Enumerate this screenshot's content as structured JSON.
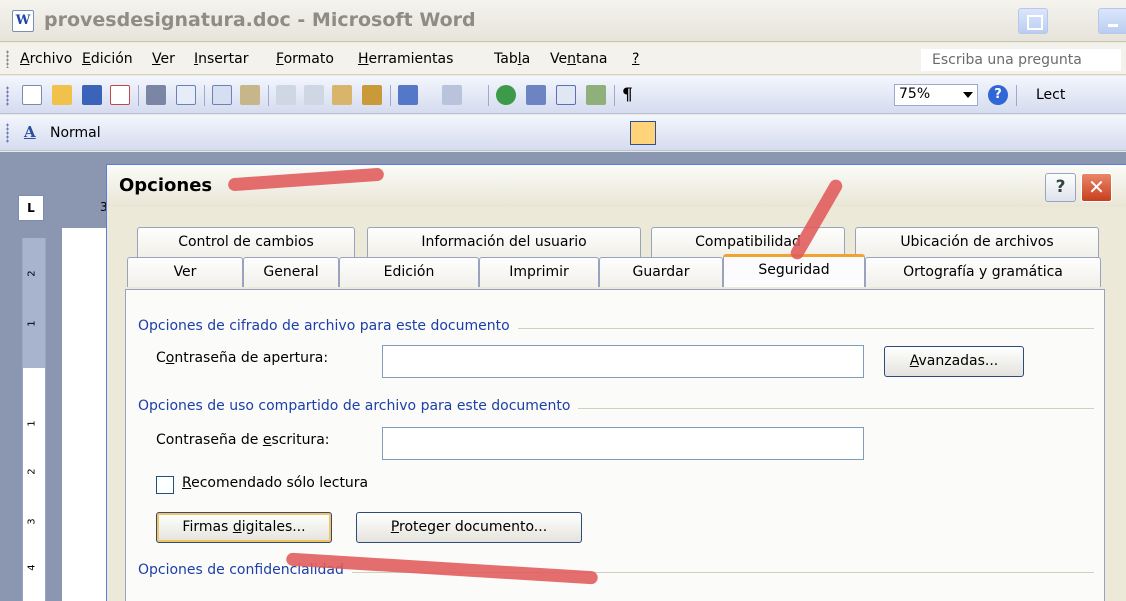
{
  "word_window": {
    "title": "provesdesignatura.doc - Microsoft Word"
  },
  "menubar": {
    "items": [
      {
        "prefix": "",
        "ul": "A",
        "rest": "rchivo"
      },
      {
        "prefix": "",
        "ul": "E",
        "rest": "dición"
      },
      {
        "prefix": "",
        "ul": "V",
        "rest": "er"
      },
      {
        "prefix": "",
        "ul": "I",
        "rest": "nsertar"
      },
      {
        "prefix": "",
        "ul": "F",
        "rest": "ormato"
      },
      {
        "prefix": "",
        "ul": "H",
        "rest": "erramientas"
      },
      {
        "prefix": "Tab",
        "ul": "l",
        "rest": "a"
      },
      {
        "prefix": "Ve",
        "ul": "n",
        "rest": "tana"
      },
      {
        "prefix": "",
        "ul": "?",
        "rest": ""
      }
    ],
    "ask_placeholder": "Escriba una pregunta"
  },
  "toolbar": {
    "zoom": "75%",
    "reading_label": "Lect"
  },
  "format_toolbar": {
    "style_value": "Normal"
  },
  "ruler": {
    "corner": "L",
    "h_number": "3",
    "v_numbers": [
      "2",
      "1",
      "1",
      "2",
      "3",
      "4"
    ]
  },
  "dialog": {
    "title": "Opciones",
    "help_glyph": "?",
    "close_glyph": "✕",
    "tabs_row1": [
      "Control de cambios",
      "Información del usuario",
      "Compatibilidad",
      "Ubicación de archivos"
    ],
    "tabs_row2": [
      "Ver",
      "General",
      "Edición",
      "Imprimir",
      "Guardar",
      "Seguridad",
      "Ortografía y gramática"
    ],
    "selected_tab": "Seguridad",
    "groups": {
      "cifrado": "Opciones de cifrado de archivo para este documento",
      "compartido": "Opciones de uso compartido de archivo para este documento",
      "confidencialidad": "Opciones de confidencialidad"
    },
    "fields": {
      "apertura": {
        "pre": "C",
        "ul": "o",
        "post": "ntraseña de apertura:",
        "value": ""
      },
      "escritura": {
        "pre": "Contraseña de ",
        "ul": "e",
        "post": "scritura:",
        "value": ""
      }
    },
    "buttons": {
      "avanzadas": {
        "pre": "",
        "ul": "A",
        "post": "vanzadas..."
      },
      "firmas": {
        "pre": "Firmas ",
        "ul": "d",
        "post": "igitales..."
      },
      "proteger": {
        "pre": "",
        "ul": "P",
        "post": "roteger documento..."
      }
    },
    "checkbox": {
      "pre": "",
      "ul": "R",
      "post": "ecomendado sólo lectura",
      "checked": false
    }
  },
  "colors": {
    "annotation": "#e05a5a",
    "selected_tab_accent": "#f0a232",
    "group_label": "#1c3fa8"
  }
}
